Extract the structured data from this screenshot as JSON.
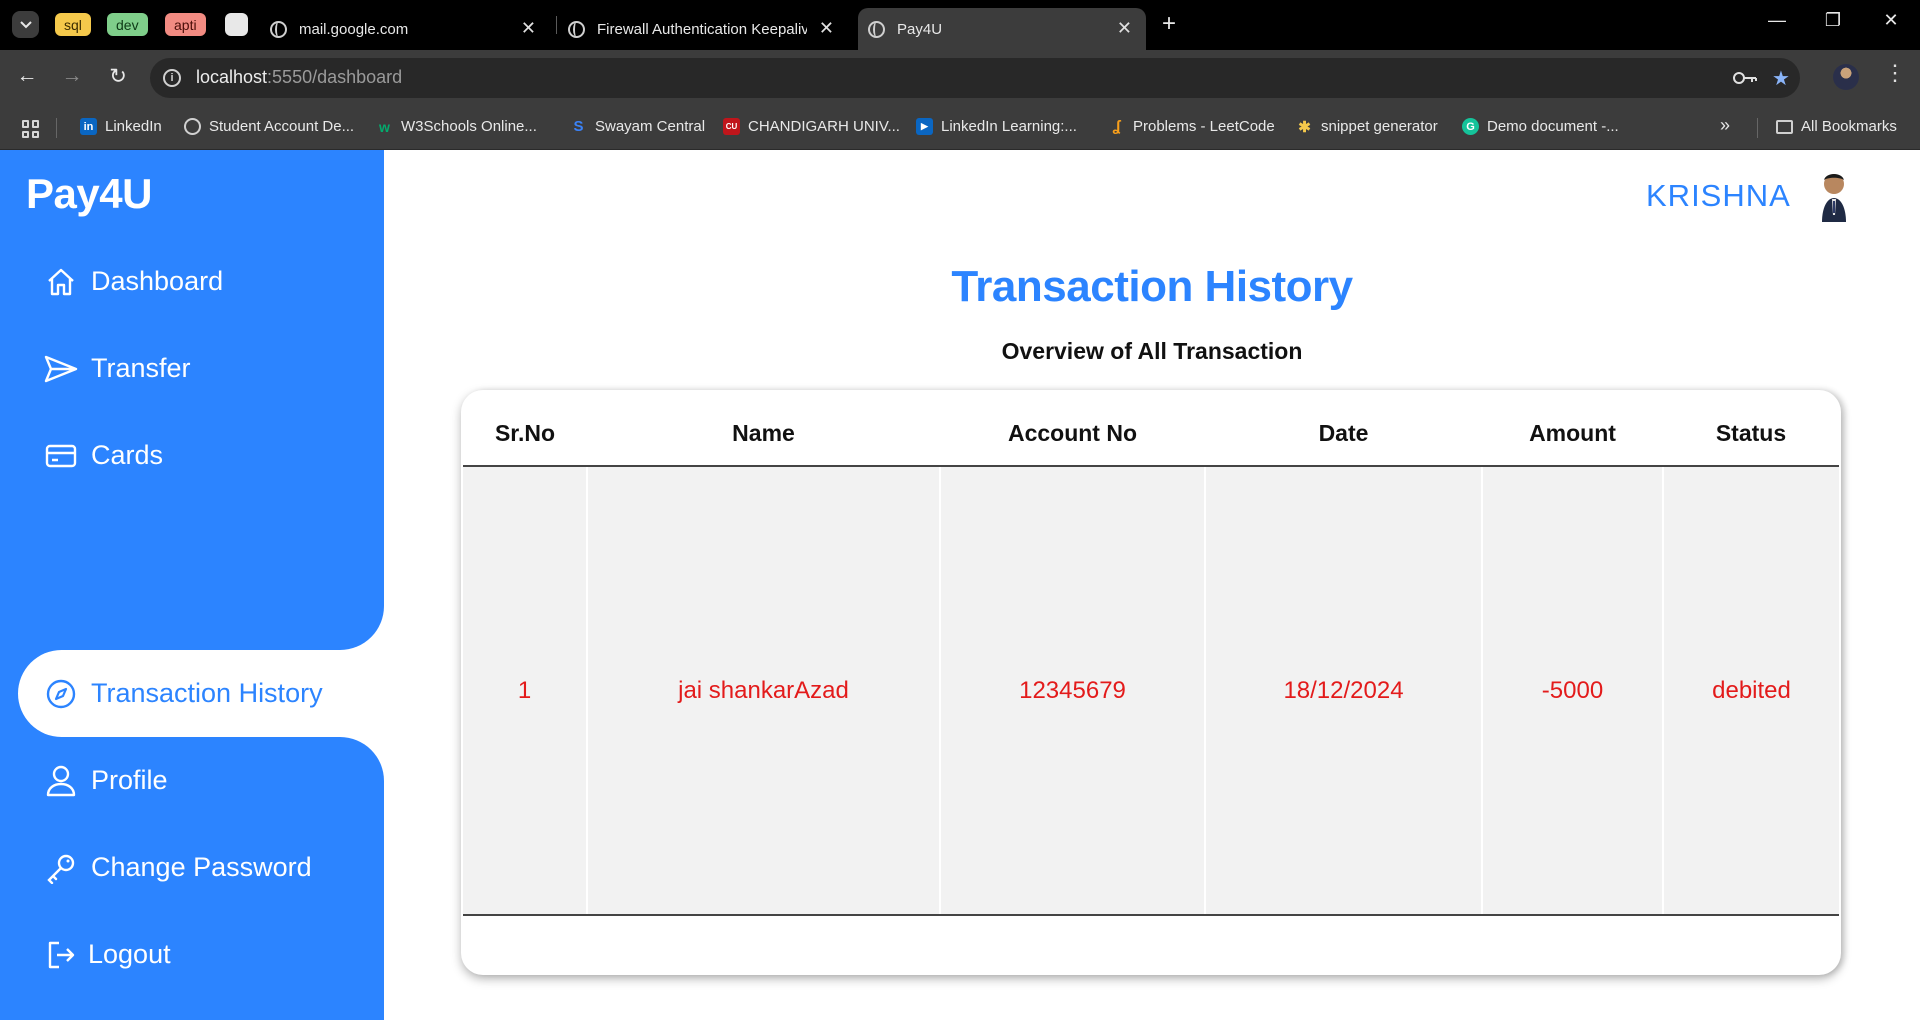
{
  "browser": {
    "tab_groups": [
      {
        "label": "sql",
        "bg": "#f5c94b",
        "fg": "#3a2c00"
      },
      {
        "label": "dev",
        "bg": "#7fce8a",
        "fg": "#0e3a16"
      },
      {
        "label": "apti",
        "bg": "#f28b82",
        "fg": "#4a0d08"
      }
    ],
    "tabs": [
      {
        "title": "mail.google.com",
        "active": false
      },
      {
        "title": "Firewall Authentication Keepaliv",
        "active": false
      },
      {
        "title": "Pay4U",
        "active": true
      }
    ],
    "url_host": "localhost",
    "url_rest": ":5550/dashboard",
    "bookmarks": [
      {
        "label": "LinkedIn",
        "icon": "linkedin-icon"
      },
      {
        "label": "Student Account De...",
        "icon": "globe-icon"
      },
      {
        "label": "W3Schools Online...",
        "icon": "w3schools-icon"
      },
      {
        "label": "Swayam Central",
        "icon": "swayam-icon"
      },
      {
        "label": "CHANDIGARH UNIV...",
        "icon": "cu-icon"
      },
      {
        "label": "LinkedIn Learning:...",
        "icon": "linkedin-learning-icon"
      },
      {
        "label": "Problems - LeetCode",
        "icon": "leetcode-icon"
      },
      {
        "label": "snippet generator",
        "icon": "snippet-icon"
      },
      {
        "label": "Demo document -...",
        "icon": "grammarly-icon"
      }
    ],
    "all_bookmarks": "All Bookmarks"
  },
  "app": {
    "brand": "Pay4U",
    "user_name": "KRISHNA",
    "nav": [
      {
        "label": "Dashboard",
        "icon": "home-icon",
        "active": false
      },
      {
        "label": "Transfer",
        "icon": "send-icon",
        "active": false
      },
      {
        "label": "Cards",
        "icon": "card-icon",
        "active": false
      },
      {
        "label": "Transaction History",
        "icon": "compass-icon",
        "active": true
      },
      {
        "label": "Profile",
        "icon": "user-icon",
        "active": false
      },
      {
        "label": "Change Password",
        "icon": "key-icon",
        "active": false
      },
      {
        "label": "Logout",
        "icon": "logout-icon",
        "active": false
      }
    ],
    "title": "Transaction History",
    "subtitle": "Overview of All Transaction",
    "table": {
      "headers": [
        "Sr.No",
        "Name",
        "Account No",
        "Date",
        "Amount",
        "Status"
      ],
      "rows": [
        [
          "1",
          "jai shankarAzad",
          "12345679",
          "18/12/2024",
          "-5000",
          "debited"
        ]
      ]
    }
  },
  "colors": {
    "accent": "#2c84ff",
    "debit_text": "#e31b1b"
  }
}
